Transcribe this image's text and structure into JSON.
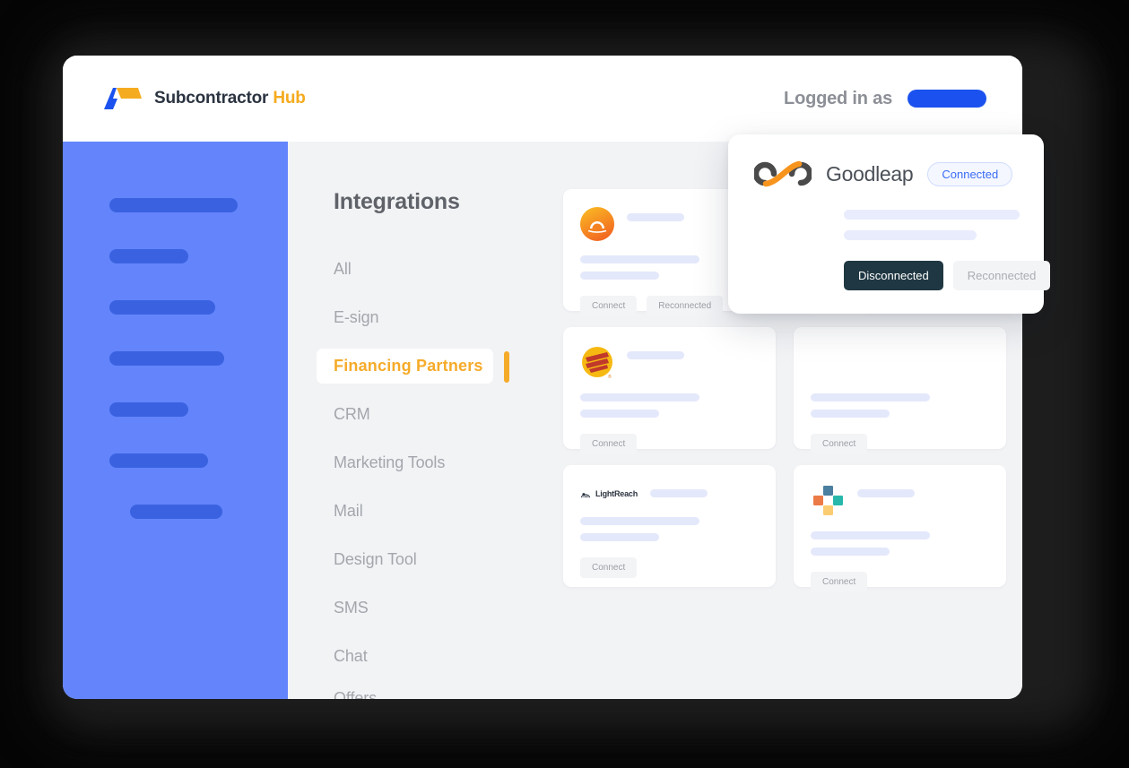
{
  "header": {
    "brand_name": "Subcontractor",
    "brand_accent": "Hub",
    "logo_icon": "subcontractor-hub-logo",
    "login_label": "Logged in as",
    "login_value_placeholder": ""
  },
  "sidebar": {
    "placeholder_widths": [
      143,
      88,
      118,
      128,
      88,
      110,
      103
    ],
    "placeholder_indent_last": 23,
    "background_color": "#6384fb",
    "bar_color": "#3a62e0"
  },
  "main": {
    "page_title": "Integrations",
    "nav": {
      "items": [
        {
          "label": "All",
          "active": false
        },
        {
          "label": "E-sign",
          "active": false
        },
        {
          "label": "Financing  Partners",
          "active": true
        },
        {
          "label": "CRM",
          "active": false
        },
        {
          "label": "Marketing Tools",
          "active": false
        },
        {
          "label": "Mail",
          "active": false
        },
        {
          "label": "Design Tool",
          "active": false
        },
        {
          "label": "SMS",
          "active": false
        },
        {
          "label": "Chat",
          "active": false
        },
        {
          "label": "Offers",
          "active": false
        }
      ],
      "active_color": "#f5ab2a",
      "inactive_color": "#a3a6ac"
    },
    "cards": [
      {
        "icon": "sunlight-financial-icon",
        "buttons": [
          "Connect",
          "Reconnected"
        ]
      },
      {
        "icon": "solar-partner-icon",
        "buttons": [
          "Connect"
        ]
      },
      {
        "icon": "sungage-icon",
        "buttons": [
          "Connect"
        ]
      },
      {
        "icon": "lightreach-icon",
        "icon_label": "LightReach",
        "buttons": [
          "Connect"
        ]
      },
      {
        "icon": "enfin-cross-icon",
        "buttons": [
          "Connect"
        ]
      }
    ]
  },
  "popup": {
    "logo_icon": "goodleap-infinity-icon",
    "title": "Goodleap",
    "status_badge": "Connected",
    "status_badge_color": "#3b6bf5",
    "primary_button": "Disconnected",
    "secondary_button": "Reconnected"
  }
}
